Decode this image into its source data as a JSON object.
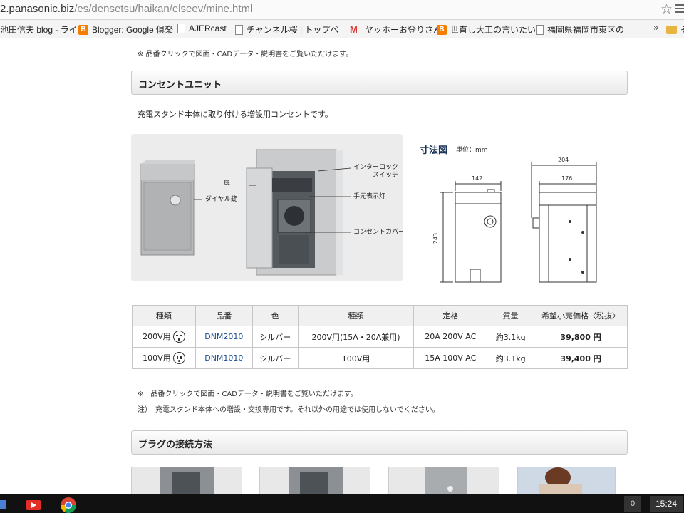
{
  "browser": {
    "url_host": "2.panasonic.biz",
    "url_path": "/es/densetsu/haikan/elseev/mine.html",
    "bookmarks": [
      {
        "label": "池田信夫 blog - ライ",
        "icon": "page-icon"
      },
      {
        "label": "Blogger: Google 倶楽",
        "icon": "blogger-icon"
      },
      {
        "label": "AJERcast",
        "icon": "page-icon"
      },
      {
        "label": "チャンネル桜 | トップペ",
        "icon": "page-icon"
      },
      {
        "label": "ヤッホーお登りさん",
        "icon": "gmail-icon"
      },
      {
        "label": "世直し大工の言いたい",
        "icon": "blogger-icon"
      },
      {
        "label": "福岡県福岡市東区の",
        "icon": "page-icon"
      }
    ],
    "more": "»",
    "folder_label": "そ"
  },
  "top_note": "※ 品番クリックで図面・CADデータ・説明書をご覧いただけます。",
  "section1": {
    "title": "コンセントユニット",
    "description": "充電スタンド本体に取り付ける増設用コンセントです。",
    "callouts": {
      "door": "扉",
      "dial_lock": "ダイヤル錠",
      "interlock": "インターロック\nスイッチ",
      "indicator": "手元表示灯",
      "outlet_cover": "コンセントカバー"
    },
    "dim_title": "寸法図",
    "dim_unit": "単位：mm",
    "dims": {
      "w_front": "142",
      "h": "243",
      "w_total": "204",
      "w_side": "176"
    }
  },
  "table": {
    "headers": [
      "種類",
      "品番",
      "色",
      "種類",
      "定格",
      "質量",
      "希望小売価格〈税抜〉"
    ],
    "rows": [
      {
        "type": "200V用",
        "part": "DNM2010",
        "color": "シルバー",
        "kind": "200V用(15A・20A兼用)",
        "rating": "20A 200V AC",
        "weight": "約3.1kg",
        "price": "39,800 円"
      },
      {
        "type": "100V用",
        "part": "DNM1010",
        "color": "シルバー",
        "kind": "100V用",
        "rating": "15A 100V AC",
        "weight": "約3.1kg",
        "price": "39,400 円"
      }
    ]
  },
  "note1": "※　品番クリックで図面・CADデータ・説明書をご覧いただけます。",
  "note2": "注）　充電スタンド本体への増設・交換専用です。それ以外の用途では使用しないでください。",
  "section2": {
    "title": "プラグの接続方法"
  },
  "taskbar": {
    "notifications": "0",
    "clock": "15:24"
  }
}
